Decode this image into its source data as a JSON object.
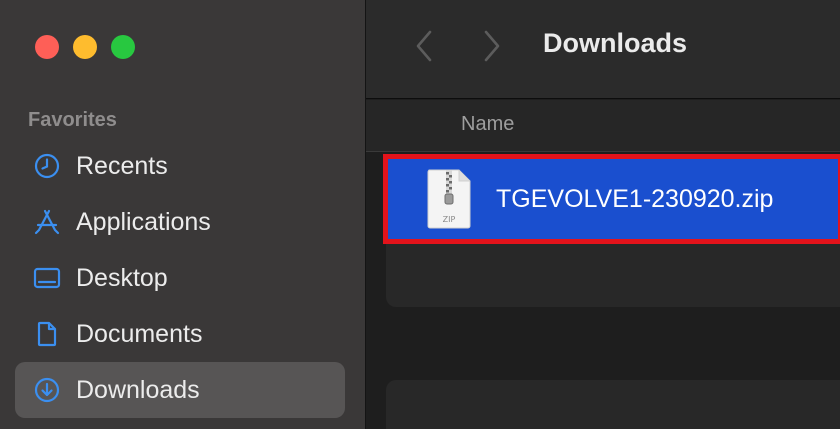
{
  "sidebar": {
    "section_title": "Favorites",
    "items": [
      {
        "label": "Recents",
        "icon": "clock-icon"
      },
      {
        "label": "Applications",
        "icon": "applications-icon"
      },
      {
        "label": "Desktop",
        "icon": "desktop-icon"
      },
      {
        "label": "Documents",
        "icon": "document-icon"
      },
      {
        "label": "Downloads",
        "icon": "download-icon",
        "selected": true
      }
    ]
  },
  "toolbar": {
    "title": "Downloads"
  },
  "list": {
    "column_name": "Name",
    "files": [
      {
        "name": "TGEVOLVE1-230920.zip",
        "icon": "zip-archive-icon",
        "icon_label": "ZIP",
        "selected": true
      }
    ]
  },
  "colors": {
    "accent_blue": "#1a4fcf",
    "highlight_red": "#e3131b",
    "sidebar_icon_blue": "#3b8ff0"
  }
}
